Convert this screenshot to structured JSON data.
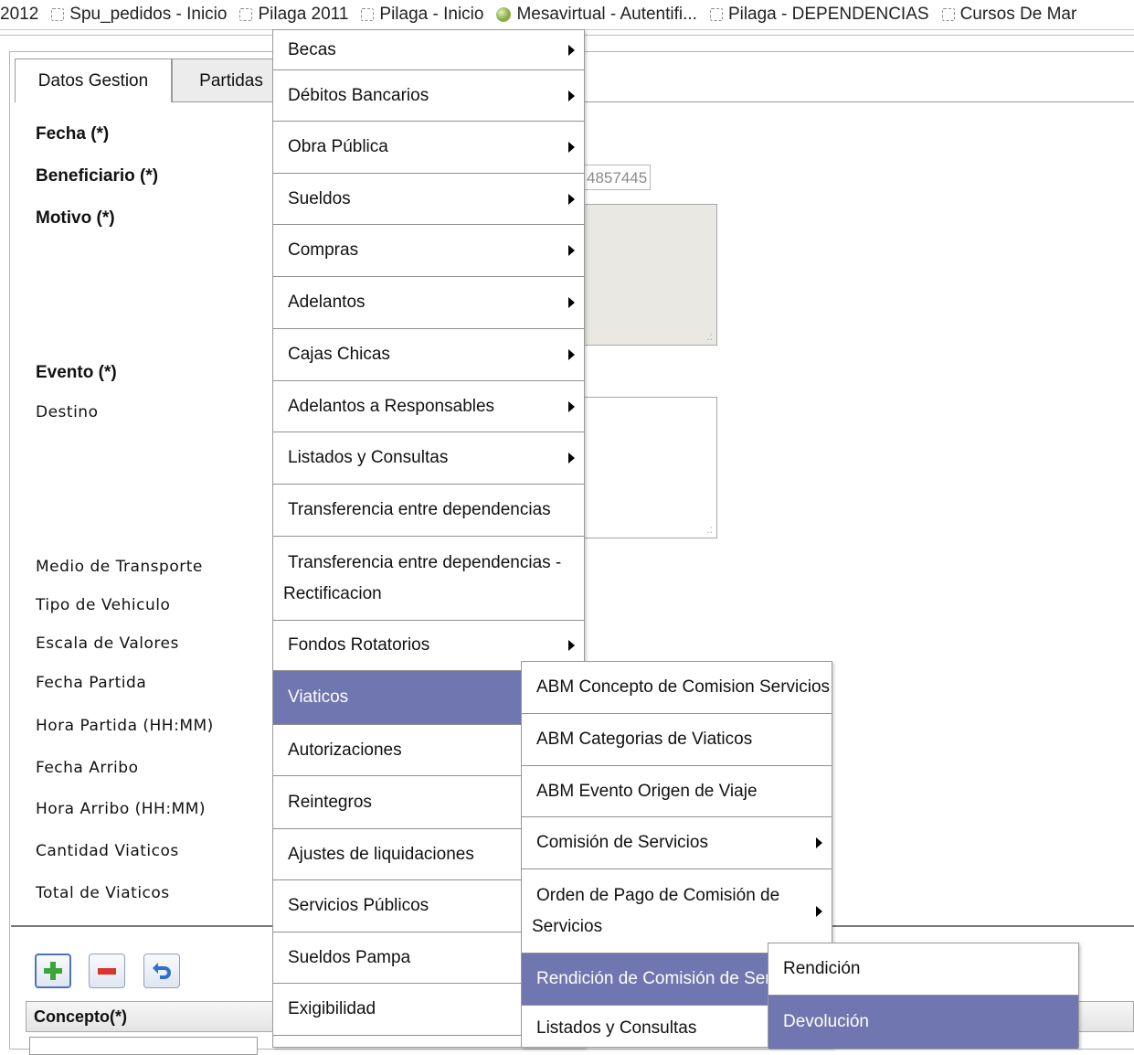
{
  "bookmarks": [
    {
      "label": "2012",
      "icon": "none"
    },
    {
      "label": "Spu_pedidos - Inicio",
      "icon": "page-icon"
    },
    {
      "label": "Pilaga  2011",
      "icon": "page-icon"
    },
    {
      "label": "Pilaga - Inicio",
      "icon": "page-icon"
    },
    {
      "label": "Mesavirtual - Autentifi...",
      "icon": "globe-icon"
    },
    {
      "label": "Pilaga - DEPENDENCIAS",
      "icon": "page-icon"
    },
    {
      "label": "Cursos De Mar",
      "icon": "page-icon"
    }
  ],
  "tabs": {
    "active": "Datos Gestion",
    "inactive": "Partidas"
  },
  "form": {
    "fecha": "Fecha (*)",
    "beneficiario": "Beneficiario (*)",
    "beneficiario_value": "4857445",
    "motivo": "Motivo (*)",
    "evento": "Evento (*)",
    "destino": "Destino",
    "medio_transporte": "Medio de Transporte",
    "tipo_vehiculo": "Tipo de Vehiculo",
    "escala_valores": "Escala de Valores",
    "fecha_partida": "Fecha Partida",
    "hora_partida": "Hora Partida (HH:MM)",
    "fecha_arribo": "Fecha Arribo",
    "hora_arribo": "Hora Arribo (HH:MM)",
    "cantidad_viaticos": "Cantidad Viaticos",
    "total_viaticos": "Total de Viaticos"
  },
  "concepto_header": "Concepto(*)",
  "menu_main": [
    "Becas",
    "Débitos Bancarios",
    "Obra Pública",
    "Sueldos",
    "Compras",
    "Adelantos",
    "Cajas Chicas",
    "Adelantos a Responsables",
    "Listados y Consultas",
    "Transferencia entre dependencias",
    "Transferencia entre dependencias -",
    "Rectificacion",
    "Fondos Rotatorios",
    "Viaticos",
    "Autorizaciones",
    "Reintegros",
    "Ajustes de liquidaciones",
    "Servicios Públicos",
    "Sueldos Pampa",
    "Exigibilidad"
  ],
  "menu_viaticos": [
    "ABM Concepto de Comision Servicios",
    "ABM Categorias de Viaticos",
    "ABM Evento Origen de Viaje",
    "Comisión de Servicios",
    "Orden de Pago de Comisión de",
    "Servicios",
    "Rendición de Comisión de Serv",
    "Listados y Consultas"
  ],
  "menu_rendicion": [
    "Rendición",
    "Devolución"
  ],
  "colors": {
    "menu_selected": "#6f76b0",
    "add_button": "#3aa63a",
    "remove_button": "#d9352b",
    "undo_button": "#2f6fd0"
  }
}
